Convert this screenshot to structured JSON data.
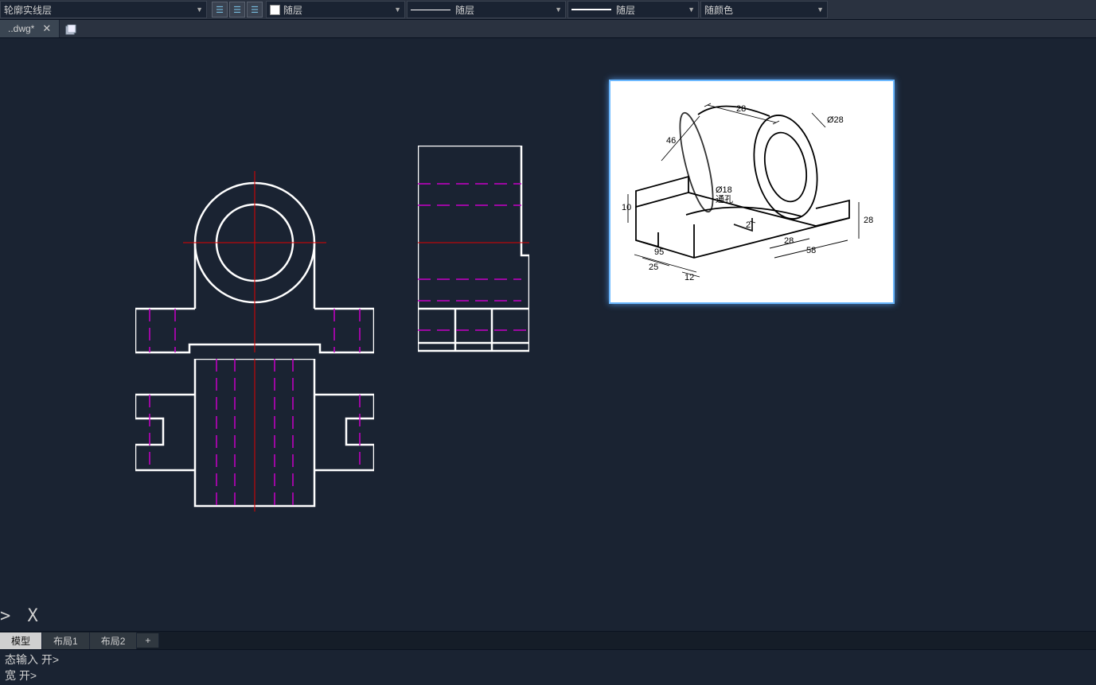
{
  "topbar": {
    "layer_dd": "轮廓实线层",
    "by_layer": "随层",
    "color": "随颜色"
  },
  "filetab": {
    "name": "..dwg*"
  },
  "prompt": "> X",
  "layout_tabs": {
    "model": "模型",
    "l1": "布局1",
    "l2": "布局2",
    "plus": "+"
  },
  "cmdline": {
    "line1": "态输入 开>",
    "line2": "宽 开>"
  },
  "iso_dims": {
    "d28a": "28",
    "phi28": "Ø28",
    "d46": "46",
    "phi18": "Ø18",
    "thru": "通孔",
    "d10": "10",
    "d25bot": "25",
    "d12": "12",
    "d2": "2",
    "d28b": "28",
    "d58": "58",
    "d28c": "28",
    "d95": "95"
  }
}
